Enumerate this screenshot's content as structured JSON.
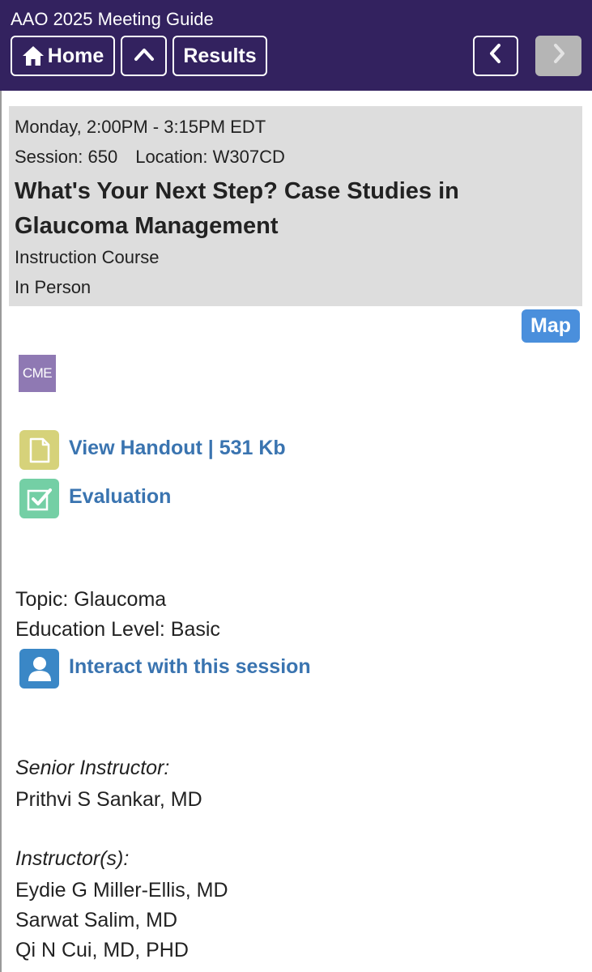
{
  "header": {
    "app_title": "AAO 2025 Meeting Guide",
    "home_label": "Home",
    "results_label": "Results",
    "up_icon": "chevron-up-icon",
    "prev_icon": "chevron-left-icon",
    "next_icon": "chevron-right-icon"
  },
  "session": {
    "datetime": "Monday,  2:00PM - 3:15PM EDT",
    "number_label": "Session: 650",
    "location_label": "Location: W307CD",
    "title": "What's Your Next Step? Case Studies in Glaucoma Management",
    "type": "Instruction Course",
    "format": "In Person"
  },
  "map_label": "Map",
  "cme_label": "CME",
  "links": {
    "handout": "View Handout | 531 Kb",
    "evaluation": "Evaluation",
    "interact": "Interact with this session"
  },
  "details": {
    "topic": "Topic: Glaucoma",
    "education_level": "Education Level: Basic"
  },
  "faculty": {
    "senior_heading": "Senior Instructor:",
    "senior": [
      "Prithvi S Sankar, MD"
    ],
    "instructors_heading": "Instructor(s):",
    "instructors": [
      "Eydie G Miller-Ellis, MD",
      "Sarwat Salim, MD",
      "Qi N Cui, MD, PHD"
    ]
  },
  "colors": {
    "header_bg": "#33225f",
    "info_bg": "#dddddd",
    "link": "#3a74b0",
    "map_button": "#4a8fdc",
    "cme_badge": "#8f79b3",
    "handout_tile": "#d6d27a",
    "evaluation_tile": "#74cfa5",
    "interact_tile": "#3a87c6",
    "disabled_button": "#b5b5b5"
  }
}
